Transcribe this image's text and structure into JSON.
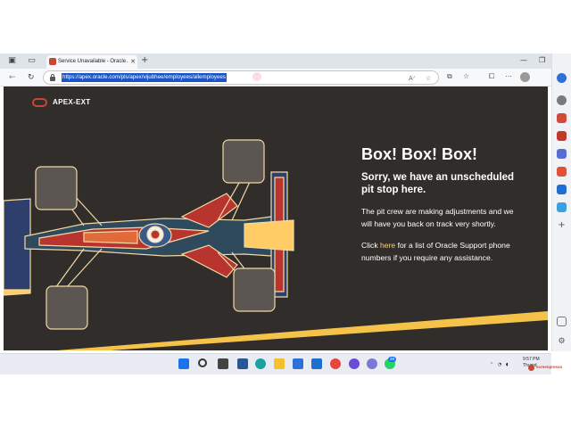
{
  "browser": {
    "tab": {
      "title": "Service Unavailable - Oracle APEX"
    },
    "address_bar": {
      "url": "https://apex.oracle.com/pls/apex/vijubhee/employees/allemployees"
    }
  },
  "page": {
    "brand": {
      "name": "APEX-EXT"
    },
    "heading": "Box! Box! Box!",
    "subheading": "Sorry, we have an unscheduled pit stop here.",
    "paragraph1": "The pit crew are making adjustments and we will have you back on track very shortly.",
    "paragraph2": {
      "prefix": "Click ",
      "link": "here",
      "suffix": " for a list of Oracle Support phone numbers if you require any assistance."
    }
  },
  "taskbar": {
    "clock_time": "9:57 PM",
    "clock_day": "Thursd",
    "notification_badge": "28"
  },
  "watermark": {
    "text": "screenpresso"
  },
  "colors": {
    "page_bg": "#312d2a",
    "oracle_red": "#c74634",
    "link_yellow": "#ffd35c",
    "selection_blue": "#1a56c8",
    "stripe_yellow": "#f5c34a"
  },
  "icons": {
    "tabstrip": [
      "workspaces-icon",
      "tab-actions-icon"
    ],
    "toolbar": [
      "back-icon",
      "refresh-icon",
      "lock-icon",
      "read-aloud-icon",
      "favorite-icon",
      "split-screen-icon",
      "favorites-icon",
      "collections-icon",
      "profile-avatar"
    ],
    "sidebar": [
      "bing-icon",
      "search-icon",
      "shopping-icon",
      "tools-icon",
      "games-icon",
      "office-icon",
      "outlook-icon",
      "drop-icon",
      "add-icon",
      "sidebar-settings-icon"
    ],
    "taskbar": [
      "windows-start-icon",
      "search-icon",
      "task-view-icon",
      "widgets-icon",
      "edge-icon",
      "file-explorer-icon",
      "store-icon",
      "mail-icon",
      "chrome-icon",
      "app-icon",
      "whatsapp-icon"
    ]
  }
}
